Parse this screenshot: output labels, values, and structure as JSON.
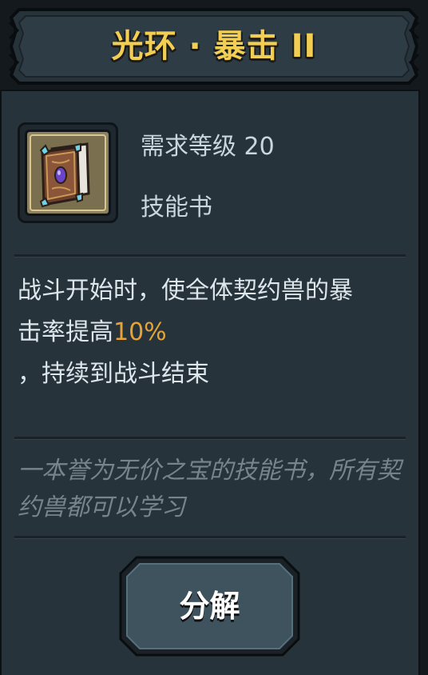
{
  "title": "光环 · 暴击 II",
  "item": {
    "icon": "skill-book-icon",
    "level_label": "需求等级 20",
    "type_label": "技能书"
  },
  "description": {
    "line1": "战斗开始时，使全体契约兽的暴",
    "line2_prefix": "击率提高",
    "highlight_value": "10%",
    "line3": "，持续到战斗结束"
  },
  "flavor": "一本誉为无价之宝的技能书，所有契约兽都可以学习",
  "actions": {
    "decompose_label": "分解"
  },
  "colors": {
    "title": "#f2cf52",
    "highlight": "#e6a437",
    "panel": "#27333b",
    "button": "#3a4f5a"
  }
}
